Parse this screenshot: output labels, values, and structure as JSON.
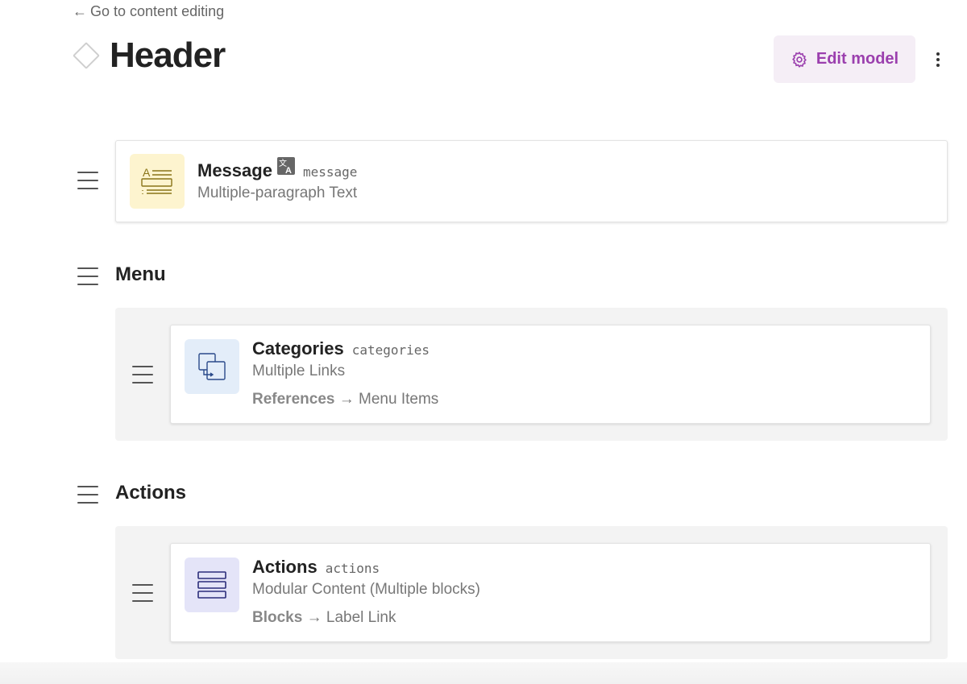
{
  "nav": {
    "back_arrow": "←",
    "back_label": "Go to content editing"
  },
  "header": {
    "title": "Header",
    "edit_button_label": "Edit model"
  },
  "fields": {
    "message": {
      "name": "Message",
      "api_key": "message",
      "type": "Multiple-paragraph Text",
      "icon": "text-field-icon",
      "localized_icon": "translate-icon"
    }
  },
  "fieldsets": [
    {
      "title": "Menu",
      "field": {
        "name": "Categories",
        "api_key": "categories",
        "type": "Multiple Links",
        "ref_label": "References",
        "ref_arrow": "→",
        "ref_target": "Menu Items",
        "icon": "multiple-links-icon"
      }
    },
    {
      "title": "Actions",
      "field": {
        "name": "Actions",
        "api_key": "actions",
        "type": "Modular Content (Multiple blocks)",
        "ref_label": "Blocks",
        "ref_arrow": "→",
        "ref_target": "Label Link",
        "icon": "modular-content-icon"
      }
    }
  ],
  "colors": {
    "accent": "#9b3fae",
    "edit_button_bg": "#f5eef6",
    "text_icon_bg": "#fdf4cf",
    "links_icon_bg": "#e3edf9",
    "blocks_icon_bg": "#e4e4f8"
  }
}
